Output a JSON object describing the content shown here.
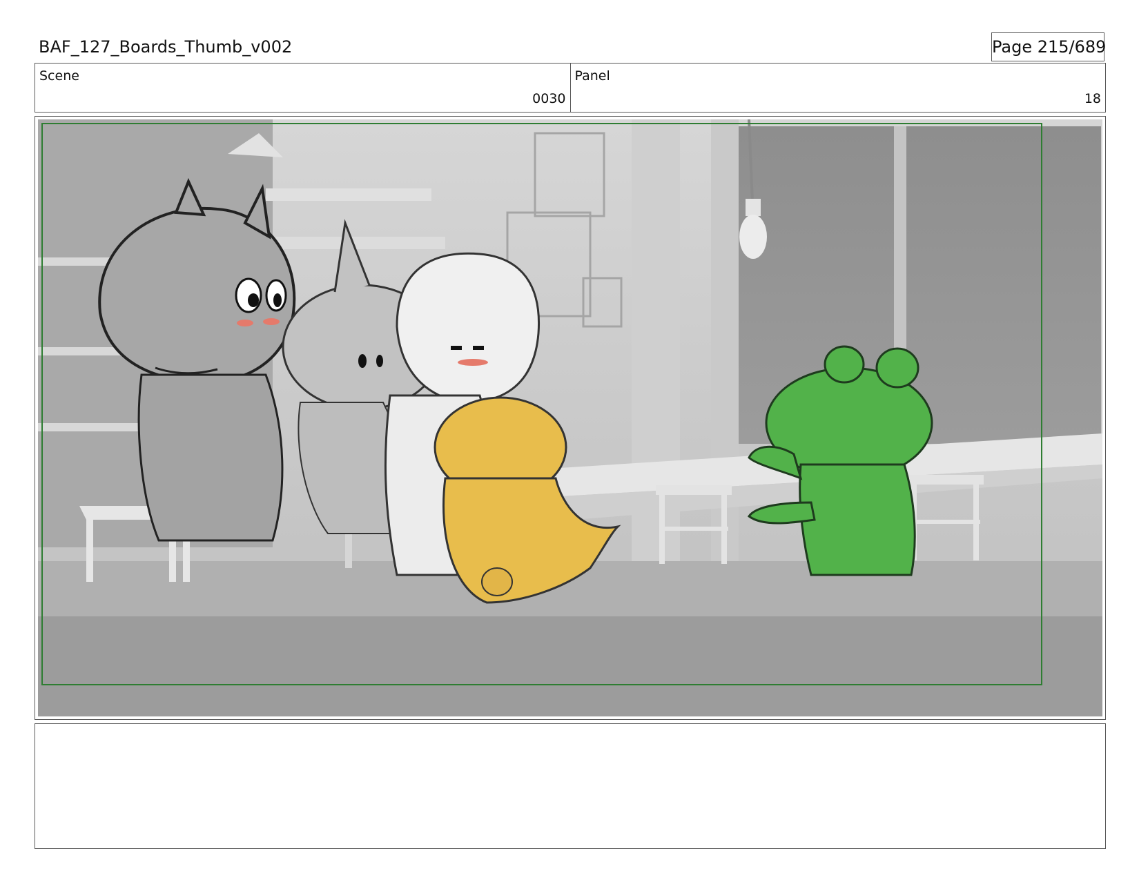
{
  "document": {
    "title": "BAF_127_Boards_Thumb_v002",
    "page_label": "Page 215/689"
  },
  "info": {
    "scene_label": "Scene",
    "scene_value": "0030",
    "panel_label": "Panel",
    "panel_value": "18"
  },
  "artwork": {
    "safe_frame_color": "#2e7d32",
    "background_tone": "#b4b4b4",
    "character_colors": {
      "yellow": "#e8bd4c",
      "green": "#52b24a"
    },
    "icons": [
      "storyboard-image"
    ]
  },
  "notes": {
    "text": ""
  }
}
